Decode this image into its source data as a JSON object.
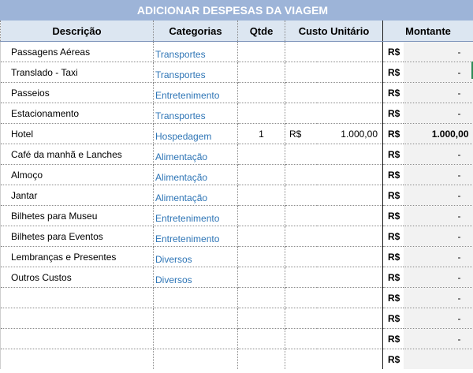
{
  "sheet": {
    "title": "ADICIONAR DESPESAS DA VIAGEM",
    "headers": {
      "descricao": "Descrição",
      "categorias": "Categorias",
      "qtde": "Qtde",
      "custo_unitario": "Custo Unitário",
      "montante": "Montante"
    },
    "rows": [
      {
        "descricao": "Passagens Aéreas",
        "categoria": "Transportes",
        "qtde": "",
        "custo_moeda": "",
        "custo": "",
        "montante_moeda": "R$",
        "montante": "-"
      },
      {
        "descricao": "Translado - Taxi",
        "categoria": "Transportes",
        "qtde": "",
        "custo_moeda": "",
        "custo": "",
        "montante_moeda": "R$",
        "montante": "-"
      },
      {
        "descricao": "Passeios",
        "categoria": "Entretenimento",
        "qtde": "",
        "custo_moeda": "",
        "custo": "",
        "montante_moeda": "R$",
        "montante": "-"
      },
      {
        "descricao": "Estacionamento",
        "categoria": "Transportes",
        "qtde": "",
        "custo_moeda": "",
        "custo": "",
        "montante_moeda": "R$",
        "montante": "-"
      },
      {
        "descricao": "Hotel",
        "categoria": "Hospedagem",
        "qtde": "1",
        "custo_moeda": "R$",
        "custo": "1.000,00",
        "montante_moeda": "R$",
        "montante": "1.000,00"
      },
      {
        "descricao": "Café da manhã e Lanches",
        "categoria": "Alimentação",
        "qtde": "",
        "custo_moeda": "",
        "custo": "",
        "montante_moeda": "R$",
        "montante": "-"
      },
      {
        "descricao": "Almoço",
        "categoria": "Alimentação",
        "qtde": "",
        "custo_moeda": "",
        "custo": "",
        "montante_moeda": "R$",
        "montante": "-"
      },
      {
        "descricao": "Jantar",
        "categoria": "Alimentação",
        "qtde": "",
        "custo_moeda": "",
        "custo": "",
        "montante_moeda": "R$",
        "montante": "-"
      },
      {
        "descricao": "Bilhetes para Museu",
        "categoria": "Entretenimento",
        "qtde": "",
        "custo_moeda": "",
        "custo": "",
        "montante_moeda": "R$",
        "montante": "-"
      },
      {
        "descricao": "Bilhetes para Eventos",
        "categoria": "Entretenimento",
        "qtde": "",
        "custo_moeda": "",
        "custo": "",
        "montante_moeda": "R$",
        "montante": "-"
      },
      {
        "descricao": "Lembranças e Presentes",
        "categoria": "Diversos",
        "qtde": "",
        "custo_moeda": "",
        "custo": "",
        "montante_moeda": "R$",
        "montante": "-"
      },
      {
        "descricao": "Outros Custos",
        "categoria": "Diversos",
        "qtde": "",
        "custo_moeda": "",
        "custo": "",
        "montante_moeda": "R$",
        "montante": "-"
      },
      {
        "descricao": "",
        "categoria": "",
        "qtde": "",
        "custo_moeda": "",
        "custo": "",
        "montante_moeda": "R$",
        "montante": "-"
      },
      {
        "descricao": "",
        "categoria": "",
        "qtde": "",
        "custo_moeda": "",
        "custo": "",
        "montante_moeda": "R$",
        "montante": "-"
      },
      {
        "descricao": "",
        "categoria": "",
        "qtde": "",
        "custo_moeda": "",
        "custo": "",
        "montante_moeda": "R$",
        "montante": "-"
      },
      {
        "descricao": "",
        "categoria": "",
        "qtde": "",
        "custo_moeda": "",
        "custo": "",
        "montante_moeda": "R$",
        "montante": ""
      }
    ]
  },
  "colors": {
    "title_bg": "#9db4d8",
    "header_bg": "#dce6f1",
    "category_text": "#2e75b6",
    "amount_bg": "#f2f2f2"
  }
}
